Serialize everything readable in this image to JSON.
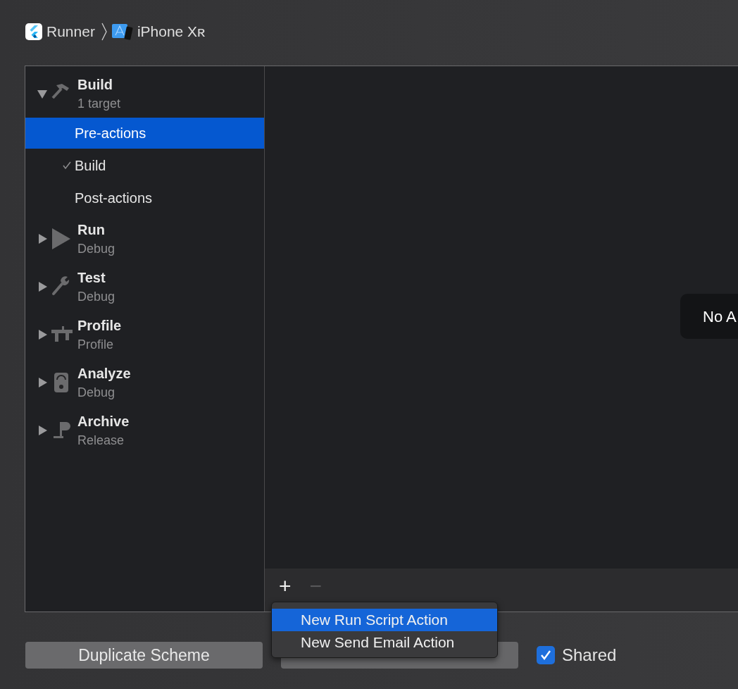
{
  "breadcrumb": [
    {
      "label": "Runner"
    },
    {
      "label": "iPhone Xʀ"
    }
  ],
  "sidebar": {
    "items": [
      {
        "title": "Build",
        "subtitle": "1 target",
        "expanded": true,
        "children": [
          {
            "label": "Pre-actions",
            "selected": true,
            "checked": false
          },
          {
            "label": "Build",
            "selected": false,
            "checked": true
          },
          {
            "label": "Post-actions",
            "selected": false,
            "checked": false
          }
        ]
      },
      {
        "title": "Run",
        "subtitle": "Debug",
        "expanded": false
      },
      {
        "title": "Test",
        "subtitle": "Debug",
        "expanded": false
      },
      {
        "title": "Profile",
        "subtitle": "Profile",
        "expanded": false
      },
      {
        "title": "Analyze",
        "subtitle": "Debug",
        "expanded": false
      },
      {
        "title": "Archive",
        "subtitle": "Release",
        "expanded": false
      }
    ]
  },
  "content": {
    "message": "No A"
  },
  "toolbar": {
    "add": "+",
    "remove": "−"
  },
  "menu": {
    "items": [
      {
        "label": "New Run Script Action",
        "selected": true
      },
      {
        "label": "New Send Email Action",
        "selected": false
      }
    ]
  },
  "buttons": [
    {
      "label": "Duplicate Scheme"
    },
    {
      "kind": "covered"
    }
  ],
  "shared": {
    "label": "Shared",
    "checked": true
  }
}
